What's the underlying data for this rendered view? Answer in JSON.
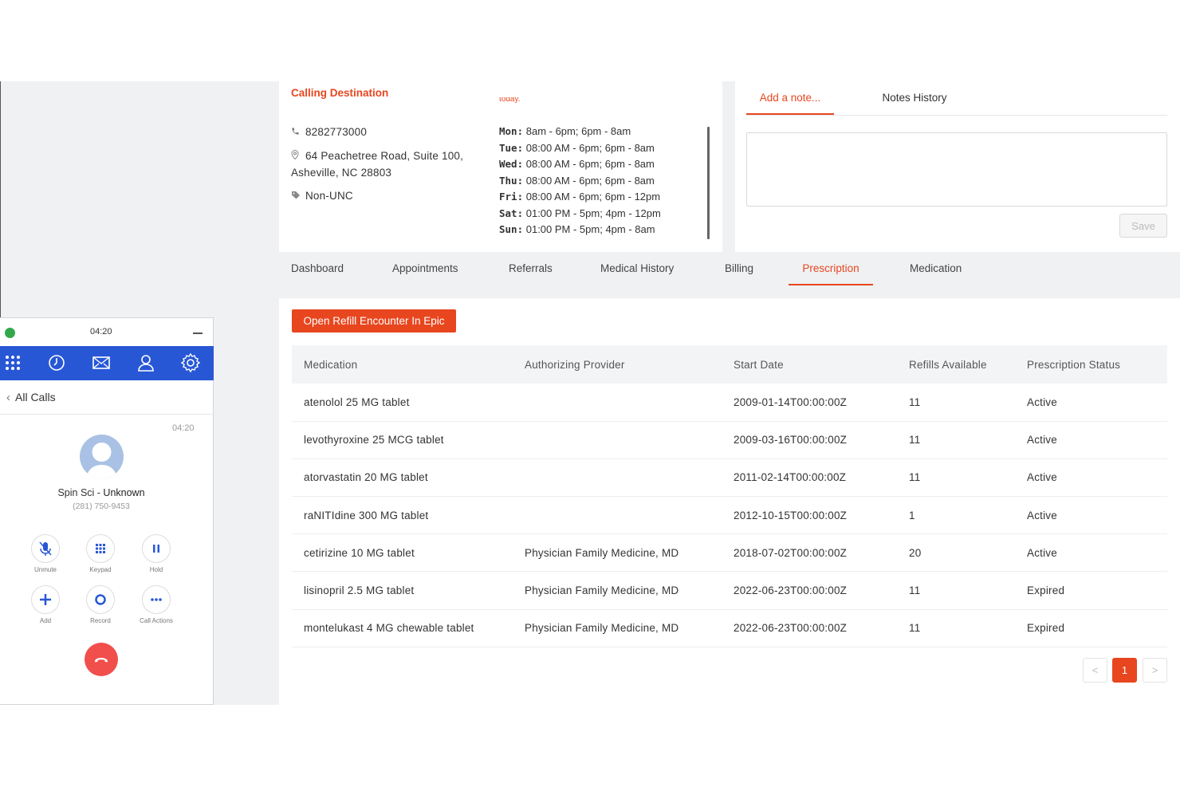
{
  "destination": {
    "title": "Calling Destination",
    "cutoff_text": "today.",
    "phone": "8282773000",
    "address_line1": "64 Peachetree Road, Suite 100,",
    "address_line2": "Asheville, NC 28803",
    "tag": "Non-UNC",
    "hours": [
      {
        "day": "Mon:",
        "time": "8am - 6pm; 6pm - 8am"
      },
      {
        "day": "Tue:",
        "time": "08:00 AM - 6pm; 6pm - 8am"
      },
      {
        "day": "Wed:",
        "time": "08:00 AM - 6pm; 6pm - 8am"
      },
      {
        "day": "Thu:",
        "time": "08:00 AM - 6pm; 6pm - 8am"
      },
      {
        "day": "Fri:",
        "time": "08:00 AM - 6pm; 6pm - 12pm"
      },
      {
        "day": "Sat:",
        "time": "01:00 PM - 5pm; 4pm - 12pm"
      },
      {
        "day": "Sun:",
        "time": "01:00 PM - 5pm; 4pm - 8am"
      }
    ]
  },
  "notes": {
    "tab_add": "Add a note...",
    "tab_history": "Notes History",
    "input_value": "",
    "save_label": "Save"
  },
  "tabs": [
    "Dashboard",
    "Appointments",
    "Referrals",
    "Medical History",
    "Billing",
    "Prescription",
    "Medication"
  ],
  "active_tab": "Prescription",
  "prescriptions": {
    "refill_button": "Open Refill Encounter In Epic",
    "columns": [
      "Medication",
      "Authorizing Provider",
      "Start Date",
      "Refills Available",
      "Prescription Status"
    ],
    "rows": [
      {
        "medication": "atenolol 25 MG tablet",
        "provider": "",
        "start": "2009-01-14T00:00:00Z",
        "refills": "11",
        "status": "Active"
      },
      {
        "medication": "levothyroxine 25 MCG tablet",
        "provider": "",
        "start": "2009-03-16T00:00:00Z",
        "refills": "11",
        "status": "Active"
      },
      {
        "medication": "atorvastatin 20 MG tablet",
        "provider": "",
        "start": "2011-02-14T00:00:00Z",
        "refills": "11",
        "status": "Active"
      },
      {
        "medication": "raNITIdine 300 MG tablet",
        "provider": "",
        "start": "2012-10-15T00:00:00Z",
        "refills": "1",
        "status": "Active"
      },
      {
        "medication": "cetirizine 10 MG tablet",
        "provider": "Physician Family Medicine, MD",
        "start": "2018-07-02T00:00:00Z",
        "refills": "20",
        "status": "Active"
      },
      {
        "medication": "lisinopril 2.5 MG tablet",
        "provider": "Physician Family Medicine, MD",
        "start": "2022-06-23T00:00:00Z",
        "refills": "11",
        "status": "Expired"
      },
      {
        "medication": "montelukast 4 MG chewable tablet",
        "provider": "Physician Family Medicine, MD",
        "start": "2022-06-23T00:00:00Z",
        "refills": "11",
        "status": "Expired"
      }
    ],
    "pagination": {
      "prev": "<",
      "current": "1",
      "next": ">"
    }
  },
  "softphone": {
    "timer": "04:20",
    "nav_icons": [
      "dialpad-icon",
      "history-icon",
      "mail-icon",
      "contacts-icon",
      "settings-icon"
    ],
    "back_label": "All Calls",
    "call_time": "04:20",
    "caller_prefix": "Spin Sci - ",
    "caller_name": "Unknown",
    "caller_number": "(281) 750-9453",
    "controls": [
      {
        "label": "Unmute",
        "icon": "mic-off-icon"
      },
      {
        "label": "Keypad",
        "icon": "keypad-icon"
      },
      {
        "label": "Hold",
        "icon": "pause-icon"
      },
      {
        "label": "Add",
        "icon": "plus-icon"
      },
      {
        "label": "Record",
        "icon": "record-icon"
      },
      {
        "label": "Call Actions",
        "icon": "more-icon"
      }
    ],
    "hangup_icon": "hangup-icon"
  },
  "colors": {
    "accent": "#e8461f",
    "phone_nav": "#2857d6",
    "status_online": "#31a84a",
    "hangup": "#f04f4b"
  }
}
